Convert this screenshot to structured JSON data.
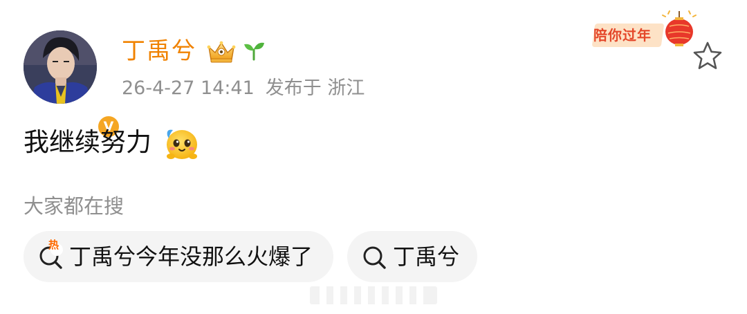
{
  "user": {
    "name": "丁禹兮",
    "timestamp": "26-4-27 14:41",
    "location_prefix": "发布于",
    "location": "浙江",
    "avatar_icon": "avatar-image",
    "verified_icon": "verified-badge-icon",
    "verified_letter": "V"
  },
  "header_badges": {
    "festival_label": "陪你过年",
    "icons": [
      "crown-icon",
      "sprout-icon",
      "lantern-icon",
      "star-icon"
    ]
  },
  "post": {
    "text": "我继续努力",
    "emoji_icon": "blushing-face-emoji-icon"
  },
  "search_section": {
    "label": "大家都在搜",
    "hot_tag": "热",
    "chips": [
      {
        "text": "丁禹兮今年没那么火爆了",
        "icon": "hot-search-icon"
      },
      {
        "text": "丁禹兮",
        "icon": "search-icon"
      }
    ]
  },
  "colors": {
    "username": "#f08200",
    "meta": "#8f8f8f",
    "chip_background": "#f4f4f4",
    "verified": "#f5a623",
    "festival_red": "#e4472a"
  }
}
